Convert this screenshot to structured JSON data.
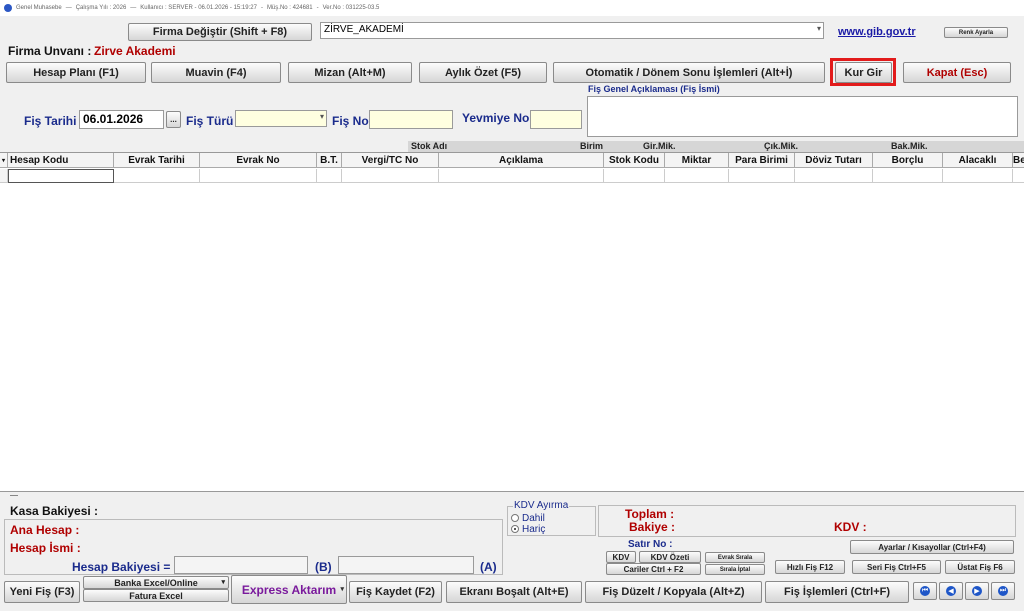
{
  "window": {
    "app_name": "Genel Muhasebe",
    "period": "Çalışma Yılı : 2026",
    "user_info": "Kullanıcı : SERVER - 06.01.2026 - 15:19:27",
    "customer_no": "Müş.No : 424681",
    "version": "Ver.No : 031225-03.5"
  },
  "header": {
    "firma_degistir": "Firma Değiştir (Shift + F8)",
    "firma_select_value": "ZİRVE_AKADEMİ",
    "gib_link": "www.gib.gov.tr",
    "renk_ayarla": "Renk Ayarla",
    "firma_unvani_label": "Firma Unvanı :",
    "firma_unvani_value": "Zirve Akademi"
  },
  "toolbar": {
    "hesap_plani": "Hesap Planı (F1)",
    "muavin": "Muavin (F4)",
    "mizan": "Mizan (Alt+M)",
    "aylik_ozet": "Aylık Özet (F5)",
    "otomatik": "Otomatik / Dönem Sonu İşlemleri (Alt+İ)",
    "kur_gir": "Kur Gir",
    "kapat": "Kapat (Esc)"
  },
  "form": {
    "fis_tarihi_label": "Fiş Tarihi",
    "fis_tarihi_value": "06.01.2026",
    "date_picker": "...",
    "fis_turu_label": "Fiş Türü",
    "fis_no_label": "Fiş No",
    "yevmiye_no_label": "Yevmiye No",
    "aciklama_label": "Fiş Genel Açıklaması (Fiş İsmi)"
  },
  "grid": {
    "sub_headers": [
      "Stok Adı",
      "Birim",
      "Gir.Mik.",
      "Çık.Mik.",
      "Bak.Mik."
    ],
    "columns": [
      "Hesap Kodu",
      "Evrak Tarihi",
      "Evrak No",
      "B.T.",
      "Vergi/TC No",
      "Açıklama",
      "Stok Kodu",
      "Miktar",
      "Para Birimi",
      "Döviz Tutarı",
      "Borçlu",
      "Alacaklı",
      "Be"
    ]
  },
  "bottom": {
    "kasa_bakiyesi": "Kasa Bakiyesi :",
    "ana_hesap": "Ana Hesap :",
    "hesap_ismi": "Hesap İsmi :",
    "hesap_bakiyesi": "Hesap Bakiyesi =",
    "b_label": "(B)",
    "a_label": "(A)",
    "kdv_ayirma": "KDV Ayırma",
    "dahil": "Dahil",
    "haric": "Hariç",
    "toplam": "Toplam :",
    "bakiye": "Bakiye :",
    "kdv": "KDV :",
    "satir_no": "Satır No :",
    "kdv_btn": "KDV",
    "kdv_ozeti": "KDV Özeti",
    "evrak_sirala": "Evrak Sırala",
    "cariler": "Cariler Ctrl + F2",
    "sirala_iptal": "Sırala İptal",
    "ayarlar": "Ayarlar / Kısayollar (Ctrl+F4)",
    "hizli_fis": "Hızlı Fiş F12",
    "seri_fis": "Seri Fiş Ctrl+F5",
    "ustat_fis": "Üstat Fiş F6"
  },
  "footer": {
    "yeni_fis": "Yeni Fiş (F3)",
    "banka_excel": "Banka Excel/Online",
    "fatura_excel": "Fatura Excel",
    "express": "Express Aktarım",
    "fis_kaydet": "Fiş Kaydet (F2)",
    "ekrani_bosalt": "Ekranı Boşalt (Alt+E)",
    "fis_duzelt": "Fiş Düzelt / Kopyala (Alt+Z)",
    "fis_islemleri": "Fiş İşlemleri (Ctrl+F)"
  },
  "colors": {
    "accent_blue": "#1a2b8c",
    "accent_red": "#b00000",
    "highlight": "#e21b1b"
  }
}
